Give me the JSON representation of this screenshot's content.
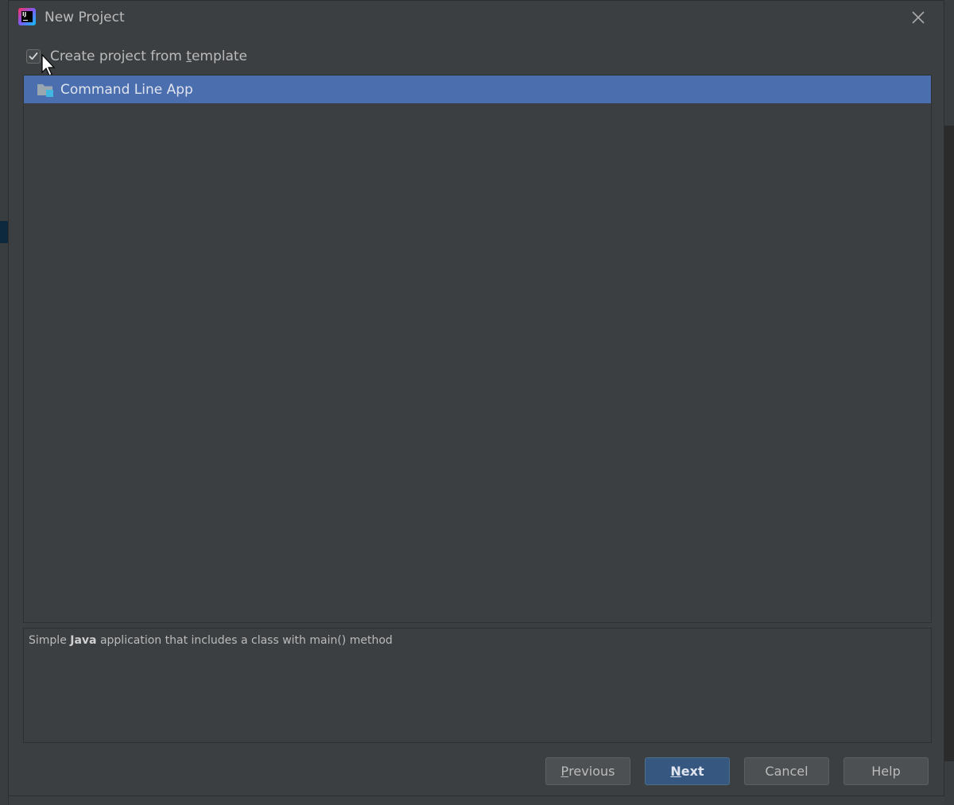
{
  "dialog": {
    "title": "New Project",
    "close_icon": "close-icon"
  },
  "template_option": {
    "label_before": "Create project from ",
    "label_mnemonic": "t",
    "label_after": "emplate",
    "checked": true
  },
  "templates": [
    {
      "label": "Command Line App",
      "icon": "folder-module-icon",
      "selected": true
    }
  ],
  "description": {
    "before": "Simple ",
    "bold": "Java",
    "after": " application that includes a class with main() method"
  },
  "buttons": {
    "previous_mnemonic": "P",
    "previous_rest": "revious",
    "next_mnemonic": "N",
    "next_rest": "ext",
    "cancel": "Cancel",
    "help": "Help"
  },
  "colors": {
    "selection": "#4b6eaf",
    "primary_button": "#365880",
    "background": "#3c3f41"
  }
}
